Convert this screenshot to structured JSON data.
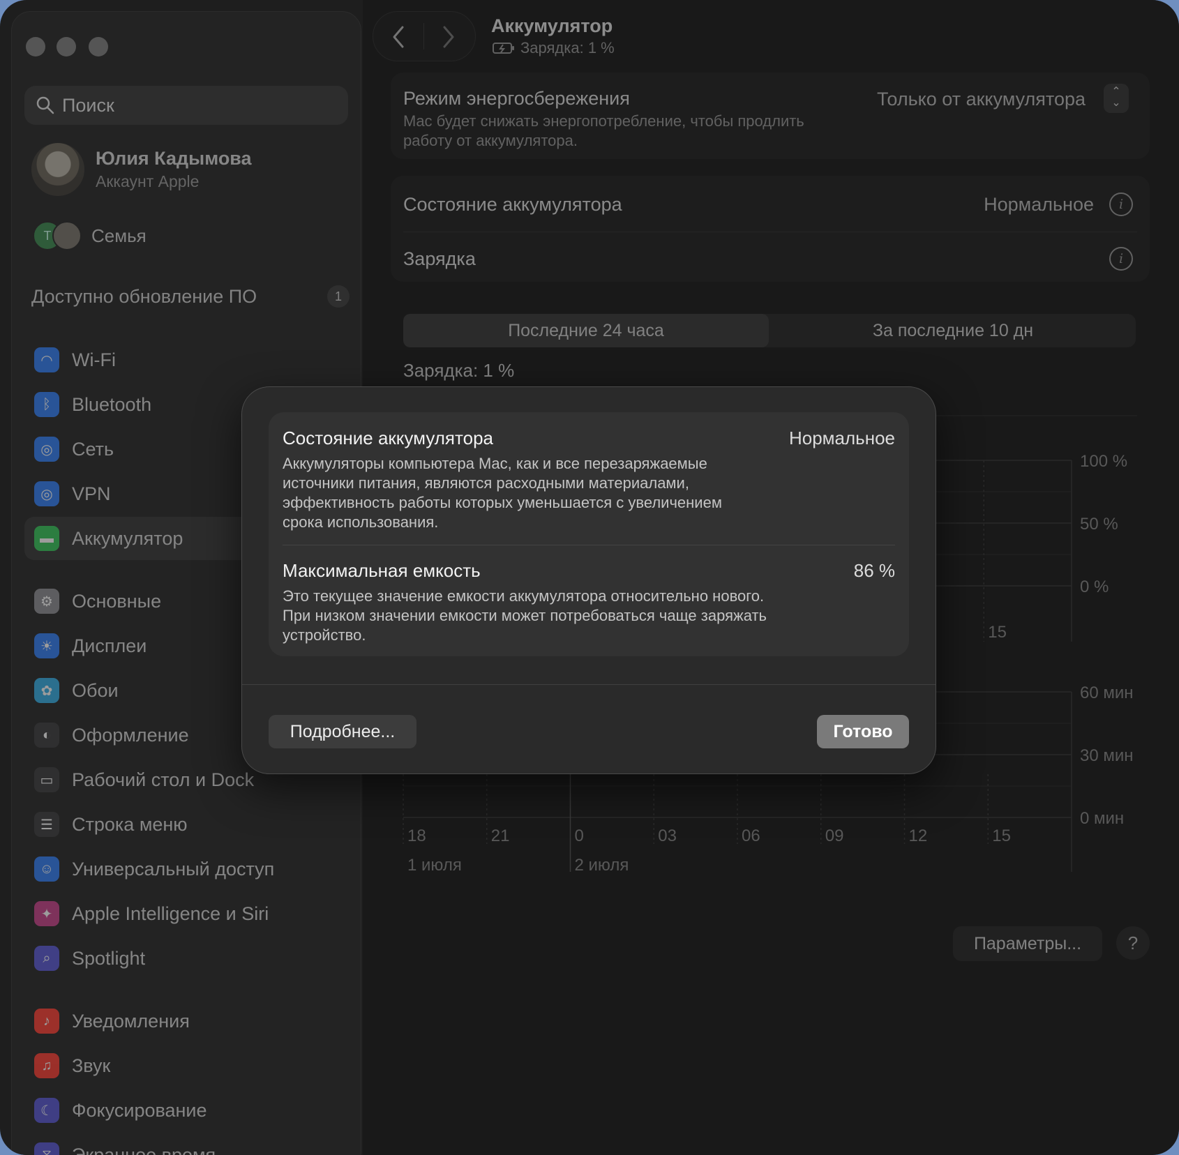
{
  "window": {
    "title": "Аккумулятор",
    "subtitle": "Зарядка: 1 %"
  },
  "sidebar": {
    "search_placeholder": "Поиск",
    "profile": {
      "name": "Юлия Кадымова",
      "sub": "Аккаунт Apple"
    },
    "family": {
      "avatar_letter": "Т",
      "label": "Семья"
    },
    "update": {
      "label": "Доступно обновление ПО",
      "count": "1"
    },
    "items": [
      {
        "label": "Wi-Fi",
        "icon": "wifi-icon",
        "color": "#2f7cf6"
      },
      {
        "label": "Bluetooth",
        "icon": "bluetooth-icon",
        "color": "#2f7cf6"
      },
      {
        "label": "Сеть",
        "icon": "globe-icon",
        "color": "#2f7cf6"
      },
      {
        "label": "VPN",
        "icon": "vpn-globe-icon",
        "color": "#2f7cf6"
      },
      {
        "label": "Аккумулятор",
        "icon": "battery-icon",
        "color": "#34c759",
        "active": true
      },
      {
        "label": "Основные",
        "icon": "gear-icon",
        "color": "#8e8e93"
      },
      {
        "label": "Дисплеи",
        "icon": "sun-icon",
        "color": "#2f7cf6"
      },
      {
        "label": "Обои",
        "icon": "flower-icon",
        "color": "#32ade6"
      },
      {
        "label": "Оформление",
        "icon": "appearance-icon",
        "color": "#3a3a3c"
      },
      {
        "label": "Рабочий стол и Dock",
        "icon": "dock-icon",
        "color": "#3a3a3c"
      },
      {
        "label": "Строка меню",
        "icon": "menubar-icon",
        "color": "#3a3a3c"
      },
      {
        "label": "Универсальный доступ",
        "icon": "accessibility-icon",
        "color": "#2f7cf6"
      },
      {
        "label": "Apple Intelligence и Siri",
        "icon": "siri-icon",
        "color": "#c9408a"
      },
      {
        "label": "Spotlight",
        "icon": "magnifier-icon",
        "color": "#5856d6"
      },
      {
        "label": "Уведомления",
        "icon": "bell-icon",
        "color": "#ff3b30"
      },
      {
        "label": "Звук",
        "icon": "speaker-icon",
        "color": "#ff3b30"
      },
      {
        "label": "Фокусирование",
        "icon": "moon-icon",
        "color": "#5856d6"
      },
      {
        "label": "Экранное время",
        "icon": "hourglass-icon",
        "color": "#5856d6"
      }
    ]
  },
  "main": {
    "power_mode": {
      "label": "Режим энергосбережения",
      "desc_line1": "Mac будет снижать энергопотребление, чтобы продлить",
      "desc_line2": "работу от аккумулятора.",
      "value": "Только от аккумулятора"
    },
    "battery_health": {
      "label": "Состояние аккумулятора",
      "value": "Нормальное"
    },
    "charging": {
      "label": "Зарядка"
    },
    "tabs": [
      {
        "label": "Последние 24 часа",
        "active": true
      },
      {
        "label": "За последние 10 дн",
        "active": false
      }
    ],
    "charge_level": "Зарядка: 1 %",
    "params_button": "Параметры...",
    "help_button": "?"
  },
  "chart_data": [
    {
      "type": "bar",
      "title": "",
      "ytick_labels": [
        "100 %",
        "50 %",
        "0 %"
      ],
      "ylim": [
        0,
        100
      ],
      "visible_xtick_labels": [
        "15"
      ],
      "series": []
    },
    {
      "type": "bar",
      "title": "",
      "ytick_labels": [
        "60 мин",
        "30 мин",
        "0 мин"
      ],
      "ylim": [
        0,
        60
      ],
      "categories": [
        "18",
        "21",
        "0",
        "03",
        "06",
        "09",
        "12",
        "15"
      ],
      "date_labels": [
        "1 июля",
        "2 июля"
      ],
      "series": []
    }
  ],
  "dialog": {
    "health": {
      "label": "Состояние аккумулятора",
      "value": "Нормальное",
      "desc_line1": "Аккумуляторы компьютера Mac, как и все перезаряжаемые",
      "desc_line2": "источники питания, являются расходными материалами,",
      "desc_line3": "эффективность работы которых уменьшается с увеличением",
      "desc_line4": "срока использования."
    },
    "capacity": {
      "label": "Максимальная емкость",
      "value": "86 %",
      "desc_line1": "Это текущее значение емкости аккумулятора относительно нового.",
      "desc_line2": "При низком значении емкости может потребоваться чаще заряжать",
      "desc_line3": "устройство."
    },
    "more_button": "Подробнее...",
    "done_button": "Готово"
  },
  "colors": {
    "window_bg": "#1e1e1e",
    "sidebar_bg": "#232323",
    "dialog_bg": "#2a2a2a",
    "done_button": "#7a7a7a"
  }
}
